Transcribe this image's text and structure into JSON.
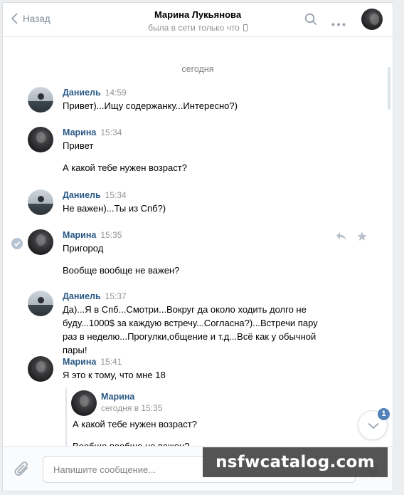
{
  "header": {
    "back_label": "Назад",
    "title": "Марина Лукьянова",
    "status": "была в сети только что"
  },
  "date_divider": "сегодня",
  "messages": [
    {
      "author": "Даниель",
      "time": "14:59",
      "lines": [
        "Привет)...Ищу содержанку...Интересно?)"
      ]
    },
    {
      "author": "Марина",
      "time": "15:34",
      "lines": [
        "Привет",
        "А какой тебе нужен возраст?"
      ]
    },
    {
      "author": "Даниель",
      "time": "15:34",
      "lines": [
        "Не важен)...Ты из Спб?)"
      ]
    },
    {
      "author": "Марина",
      "time": "15:35",
      "lines": [
        "Пригород",
        "Вообще вообще не важен?"
      ]
    },
    {
      "author": "Даниель",
      "time": "15:37",
      "lines": [
        "Да)...Я в Спб...Смотри...Вокруг да около ходить долго не буду...1000$ за каждую встречу...Согласна?)...Встречи пару раз в неделю...Прогулки,общение и т.д...Всё как у обычной пары!"
      ]
    },
    {
      "author": "Марина",
      "time": "15:41",
      "lines": [
        "Я это к тому, что мне 18"
      ]
    }
  ],
  "forwarded": {
    "author": "Марина",
    "time": "сегодня в 15:35",
    "lines": [
      "А какой тебе нужен возраст?",
      "Вообще вообще не важен?"
    ]
  },
  "unread_badge": "1",
  "composer": {
    "placeholder": "Напишите сообщение..."
  },
  "watermark": "nsfwcatalog.com",
  "colors": {
    "link": "#2a5885",
    "accent": "#5181b8",
    "muted": "#939393"
  }
}
